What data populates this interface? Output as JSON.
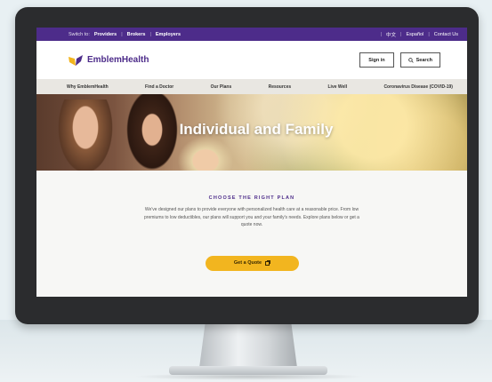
{
  "utility_bar": {
    "switch_label": "Switch to:",
    "links": [
      "Providers",
      "Brokers",
      "Employers"
    ],
    "right_links": [
      "中文",
      "Español",
      "Contact Us"
    ]
  },
  "header": {
    "logo_text": "EmblemHealth",
    "sign_in": "Sign in",
    "search": "Search"
  },
  "main_nav": {
    "items": [
      "Why EmblemHealth",
      "Find a Doctor",
      "Our Plans",
      "Resources",
      "Live Well",
      "Coronavirus Disease (COVID-19)"
    ]
  },
  "hero": {
    "title": "Individual and Family"
  },
  "section": {
    "kicker": "CHOOSE THE RIGHT PLAN",
    "description": "We've designed our plans to provide everyone with personalized health care at a reasonable price. From low premiums to low deductibles, our plans will support you and your family's needs. Explore plans below or get a quote now.",
    "cta": "Get a Quote"
  },
  "colors": {
    "brand_purple": "#4d2c8a",
    "accent_yellow": "#f2b51f"
  }
}
